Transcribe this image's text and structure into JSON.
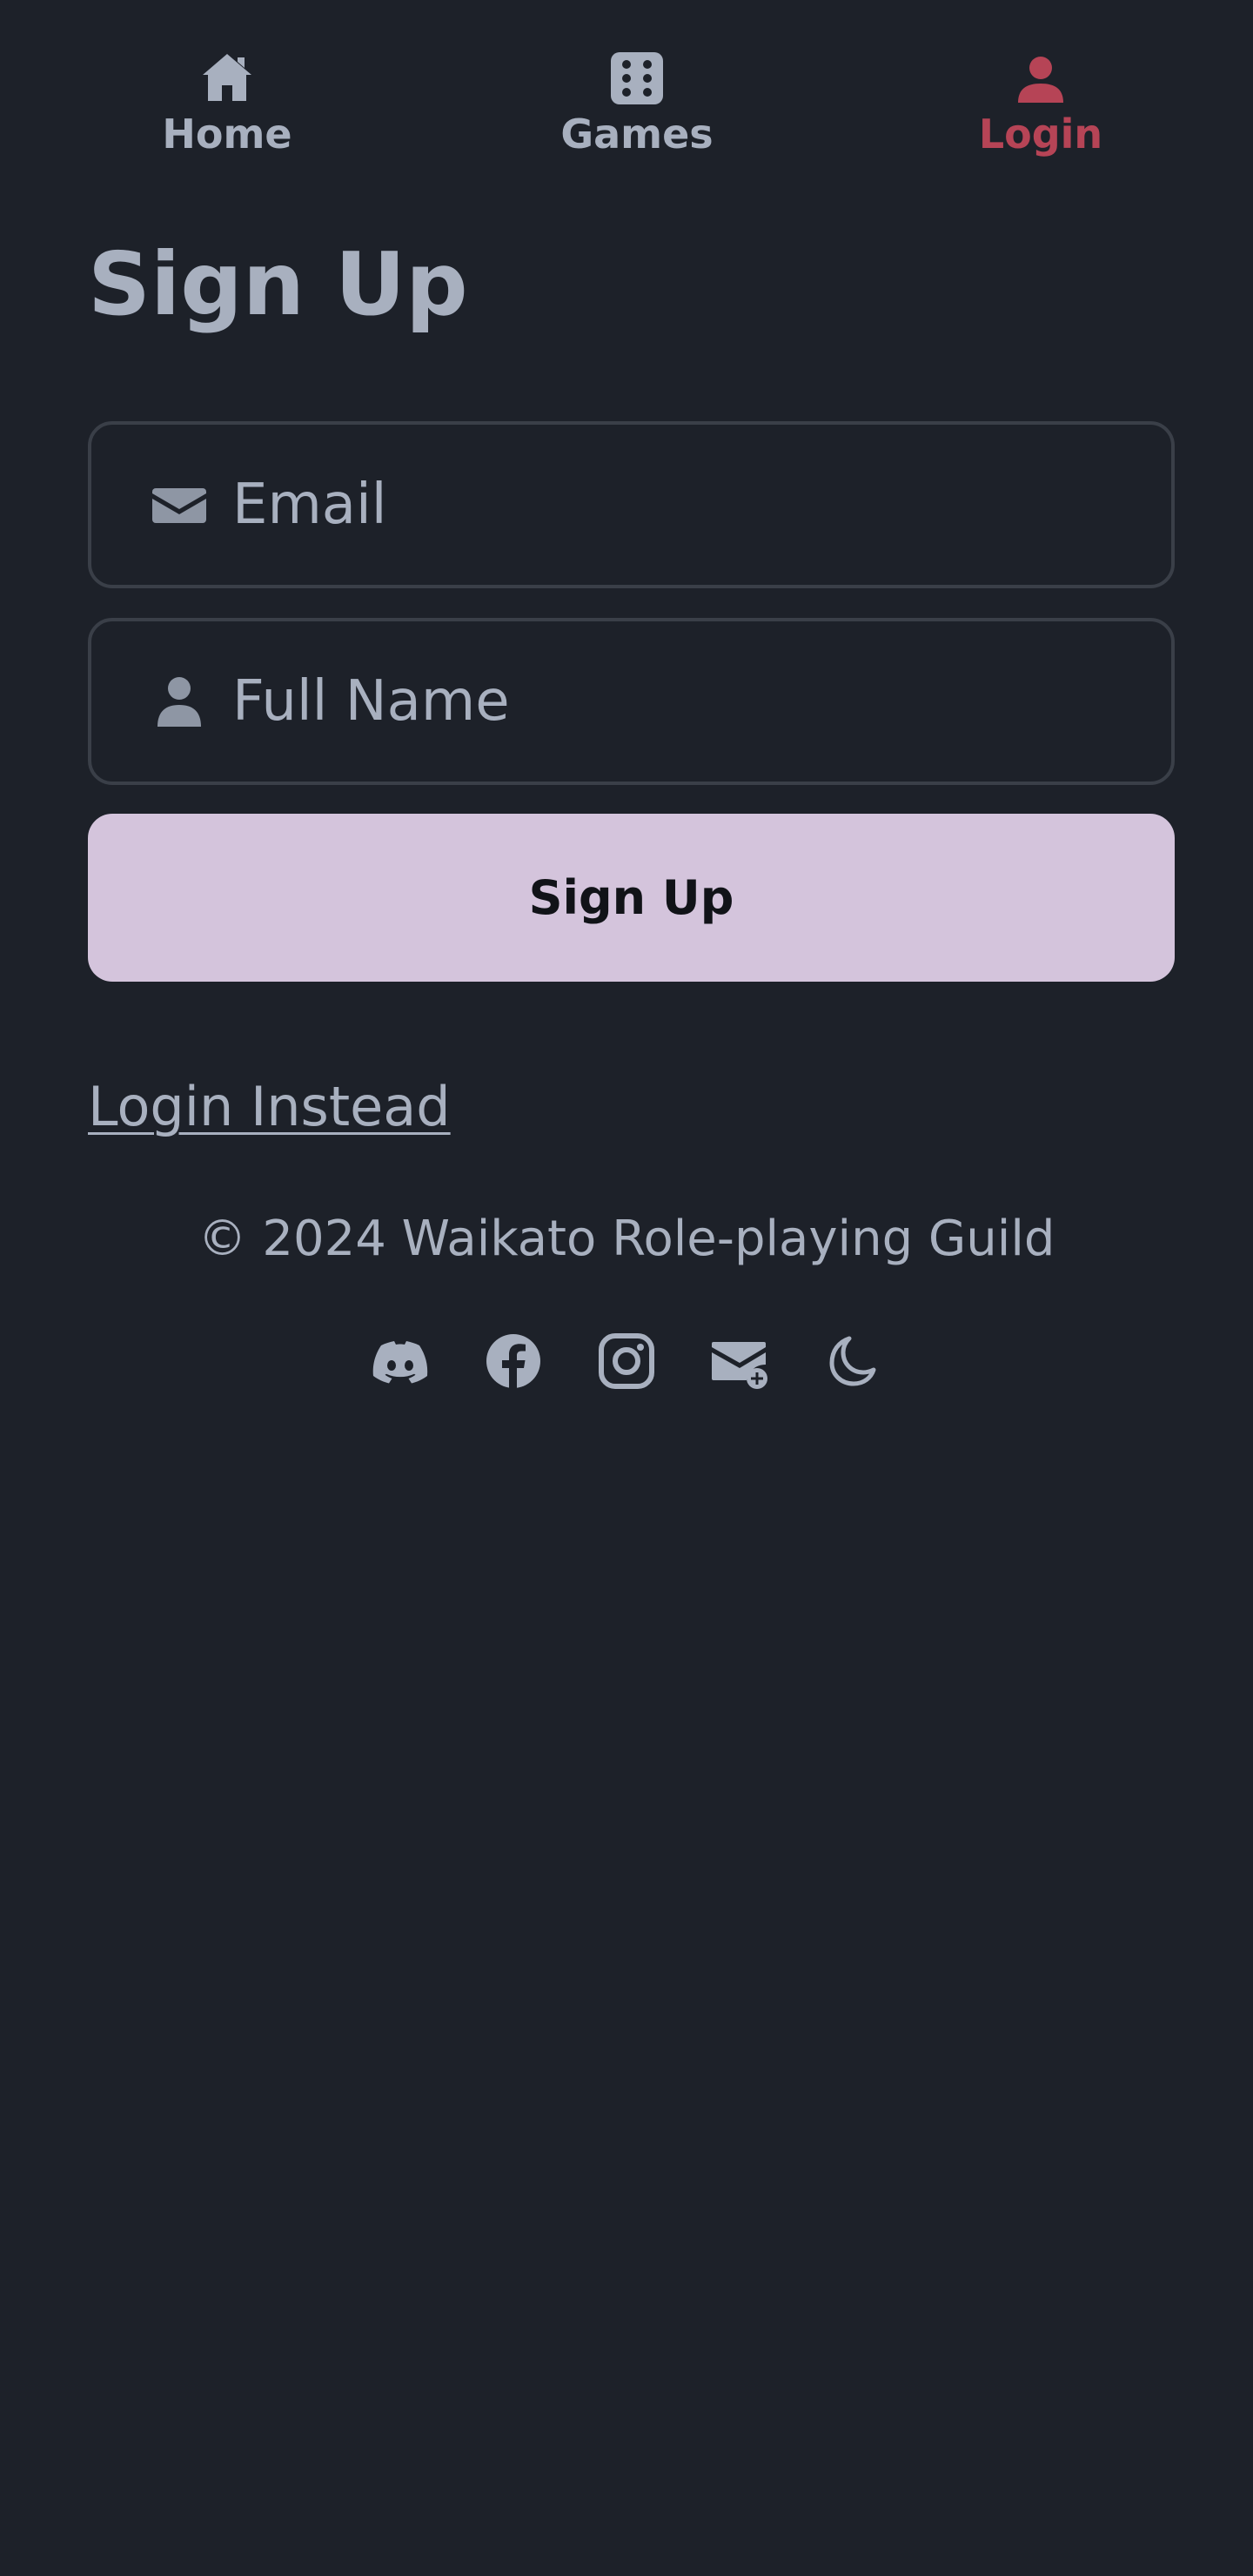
{
  "nav": {
    "items": [
      {
        "label": "Home",
        "icon": "home-icon"
      },
      {
        "label": "Games",
        "icon": "dice-icon"
      },
      {
        "label": "Login",
        "icon": "user-icon",
        "active": true
      }
    ],
    "active_color": "#b64456"
  },
  "main": {
    "title": "Sign Up",
    "email_field": {
      "placeholder": "Email",
      "value": "",
      "icon": "envelope-icon"
    },
    "name_field": {
      "placeholder": "Full Name",
      "value": "",
      "icon": "user-icon"
    },
    "submit_label": "Sign Up",
    "login_link": "Login Instead"
  },
  "footer": {
    "copyright": "© 2024 Waikato Role-playing Guild",
    "social_icons": [
      "discord-icon",
      "facebook-icon",
      "instagram-icon",
      "mail-plus-icon",
      "moon-icon"
    ]
  },
  "colors": {
    "background": "#1d2129",
    "text": "#a8b0bf",
    "button_bg": "#d4c4dc",
    "border": "#3a3f48"
  }
}
